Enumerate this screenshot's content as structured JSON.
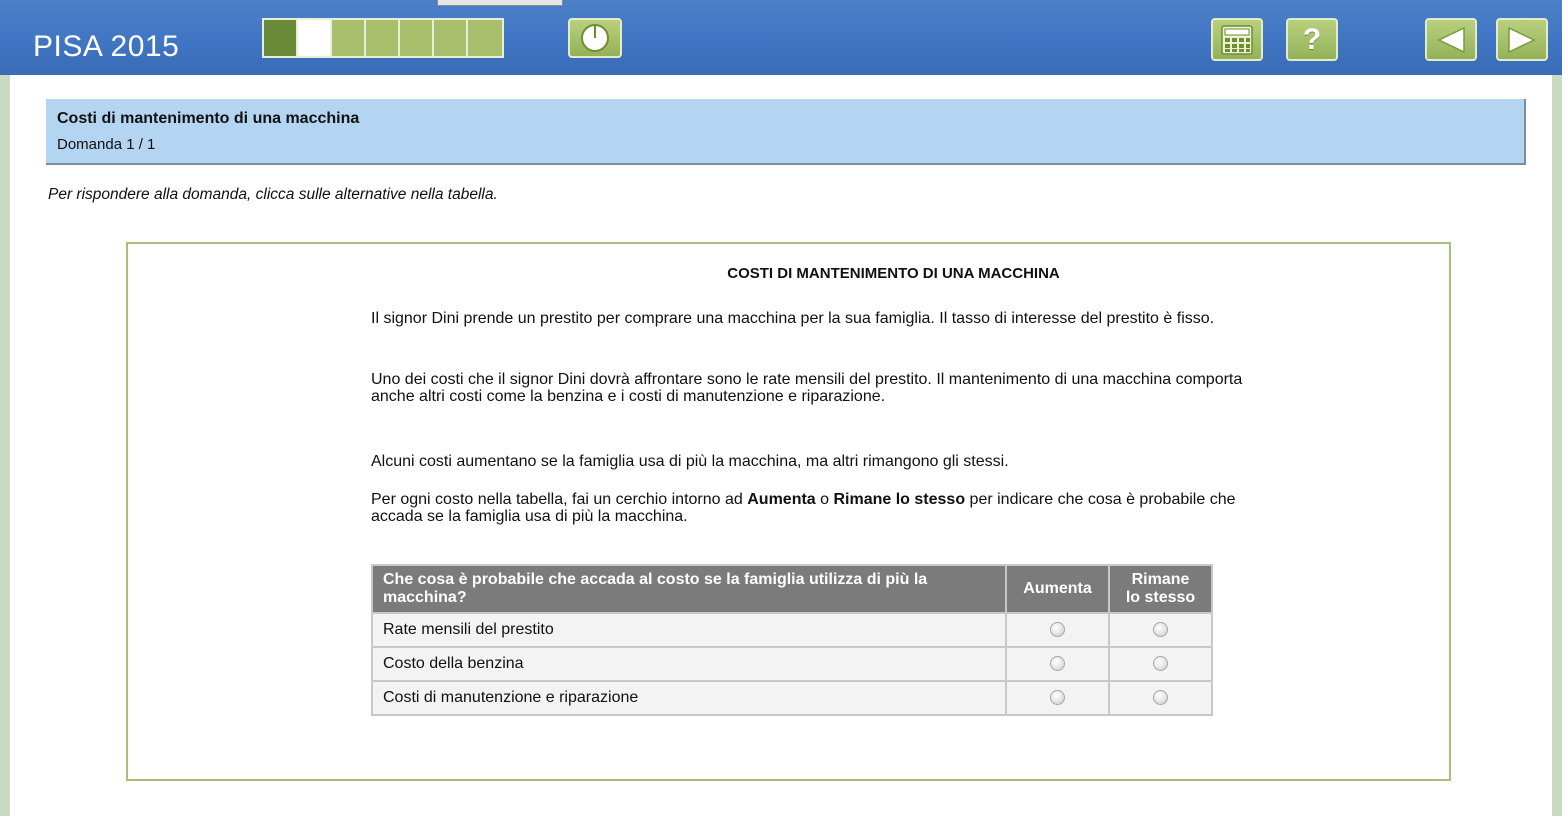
{
  "app": {
    "title": "PISA 2015"
  },
  "navigation": {
    "progress": {
      "total_segments": 7,
      "completed": 1,
      "current_index": 2
    },
    "buttons": {
      "timer": "clock-icon",
      "calculator": "calculator-icon",
      "help": "?",
      "previous": "arrow-left-icon",
      "next": "arrow-right-icon"
    }
  },
  "unit": {
    "title": "Costi di mantenimento di una macchina",
    "question_counter": "Domanda 1 / 1"
  },
  "instruction": "Per rispondere alla domanda, clicca sulle alternative nella tabella.",
  "stimulus": {
    "title": "COSTI DI MANTENIMENTO DI UNA MACCHINA",
    "paragraphs": {
      "p1": "Il signor Dini prende un prestito per comprare una macchina per la sua famiglia. Il tasso di interesse del prestito è fisso.",
      "p2": "Uno dei costi che il signor Dini dovrà affrontare sono le rate mensili del prestito. Il mantenimento di una macchina comporta anche altri costi come la benzina e i costi di manutenzione e riparazione.",
      "p3": "Alcuni costi aumentano se la famiglia usa di più la macchina, ma altri rimangono gli stessi.",
      "p4_pre": "Per ogni costo nella tabella, fai un cerchio intorno ad ",
      "p4_bold1": "Aumenta",
      "p4_mid": " o ",
      "p4_bold2": "Rimane lo stesso",
      "p4_post": " per indicare che cosa è probabile che accada se la famiglia usa di più la macchina."
    }
  },
  "table": {
    "headers": {
      "question": "Che cosa è probabile che accada al costo se la famiglia utilizza di più la macchina?",
      "option1": "Aumenta",
      "option2_line1": "Rimane",
      "option2_line2": "lo stesso"
    },
    "rows": [
      {
        "label": "Rate mensili del prestito",
        "selected": null
      },
      {
        "label": "Costo della benzina",
        "selected": null
      },
      {
        "label": "Costi di manutenzione e riparazione",
        "selected": null
      }
    ]
  }
}
